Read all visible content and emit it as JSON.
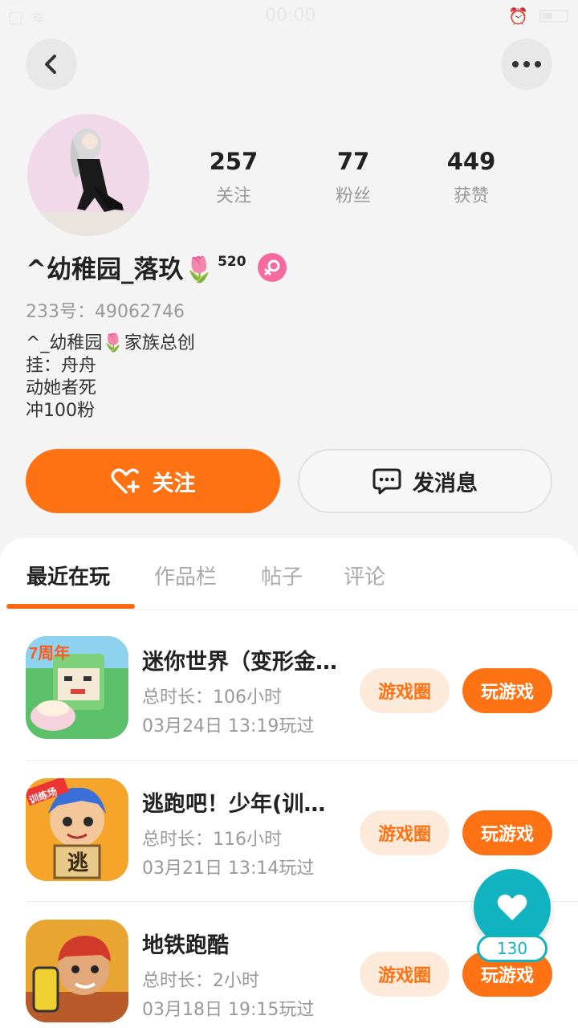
{
  "status_bar": {
    "time": "00:00"
  },
  "profile": {
    "stats": [
      {
        "value": "257",
        "label": "关注"
      },
      {
        "value": "77",
        "label": "粉丝"
      },
      {
        "value": "449",
        "label": "获赞"
      }
    ],
    "nickname": "^幼稚园_落玖🌷",
    "level": "520",
    "uid": "233号：49062746",
    "bio_lines": [
      "^_幼稚园🌷家族总创",
      "挂：舟舟",
      "动她者死",
      "冲100粉"
    ]
  },
  "actions": {
    "follow_label": "关注",
    "message_label": "发消息"
  },
  "tabs": [
    {
      "label": "最近在玩",
      "active": true
    },
    {
      "label": "作品栏",
      "active": false
    },
    {
      "label": "帖子",
      "active": false
    },
    {
      "label": "评论",
      "active": false
    }
  ],
  "games": [
    {
      "title": "迷你世界（变形金刚）",
      "duration": "总时长：106小时",
      "played": "03月24日 13:19玩过",
      "icon": "mini-world-icon",
      "circle_label": "游戏圈",
      "play_label": "玩游戏"
    },
    {
      "title": "逃跑吧！少年(训练场)",
      "duration": "总时长：116小时",
      "played": "03月21日 13:14玩过",
      "icon": "escape-boy-icon",
      "circle_label": "游戏圈",
      "play_label": "玩游戏"
    },
    {
      "title": "地铁跑酷",
      "duration": "总时长：2小时",
      "played": "03月18日 19:15玩过",
      "icon": "subway-surfers-icon",
      "circle_label": "游戏圈",
      "play_label": "玩游戏"
    }
  ],
  "like_fab": {
    "count": "130"
  },
  "colors": {
    "accent": "#ff7214",
    "fab": "#12b3c0",
    "gender": "#f76aa0"
  }
}
